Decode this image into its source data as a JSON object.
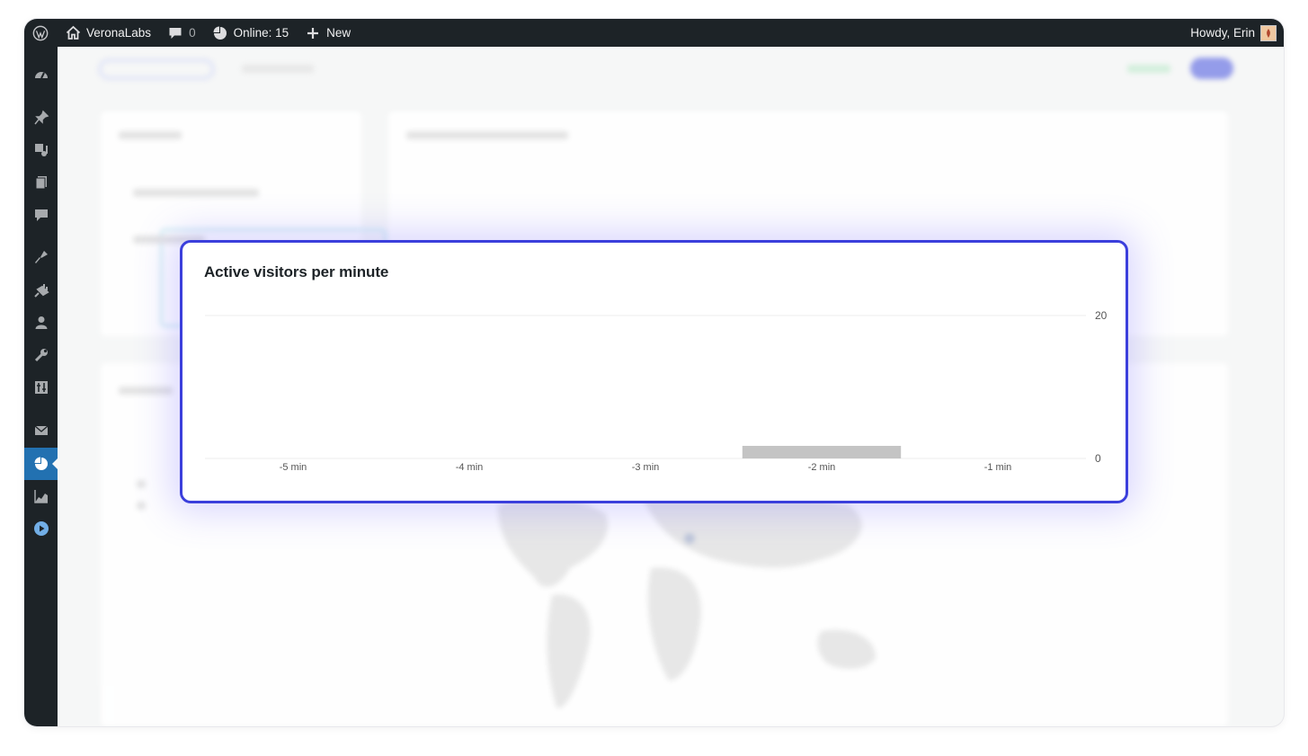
{
  "admin_bar": {
    "site_name": "VeronaLabs",
    "comments_count": "0",
    "online_label": "Online: 15",
    "new_label": "New",
    "greeting": "Howdy, Erin"
  },
  "sidebar": {
    "icons": [
      "dashboard-icon",
      "pin-icon",
      "media-icon",
      "pages-icon",
      "comments-icon",
      "appearance-icon",
      "plugins-icon",
      "users-icon",
      "tools-icon",
      "settings-icon",
      "mail-icon",
      "statistics-icon",
      "analytics-icon",
      "play-icon"
    ],
    "active": "statistics-icon"
  },
  "focus_card": {
    "title": "Active visitors per minute"
  },
  "chart_data": {
    "type": "bar",
    "title": "Active visitors per minute",
    "categories": [
      "-5 min",
      "-4 min",
      "-3 min",
      "-2 min",
      "-1 min"
    ],
    "values": [
      0,
      0,
      0,
      1,
      0
    ],
    "ylim": [
      0,
      20
    ],
    "y_ticks": [
      "20",
      "0"
    ],
    "y_axis_side": "right",
    "bar_color": "#c4c4c4",
    "grid": true
  },
  "colors": {
    "highlight_border": "#3b3fdc",
    "admin_bar": "#1d2327",
    "active_menu": "#2271b1"
  }
}
